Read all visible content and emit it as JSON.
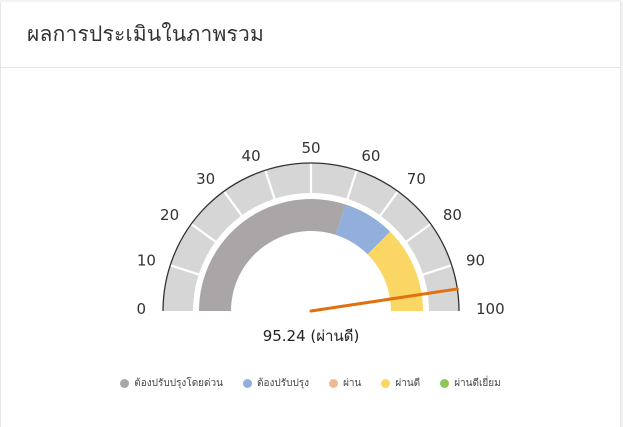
{
  "header": {
    "title": "ผลการประเมินในภาพรวม"
  },
  "chart_data": {
    "type": "gauge",
    "title": "",
    "min": 0,
    "max": 100,
    "ticks": [
      "0",
      "10",
      "20",
      "30",
      "40",
      "50",
      "60",
      "70",
      "80",
      "90",
      "100"
    ],
    "value": 95.24,
    "value_label": "95.24 (ผ่านดี)",
    "bands": [
      {
        "name": "ต้องปรับปรุงโดยด่วน",
        "from": 0,
        "to": 60,
        "color": "#aaa6a8"
      },
      {
        "name": "ต้องปรับปรุง",
        "from": 60,
        "to": 75,
        "color": "#92aedb"
      },
      {
        "name": "ผ่าน",
        "from": 75,
        "to": 75,
        "color": "#f0b893"
      },
      {
        "name": "ผ่านดี",
        "from": 75,
        "to": 100,
        "color": "#fad765"
      },
      {
        "name": "ผ่านดีเยี่ยม",
        "from": 100,
        "to": 100,
        "color": "#8ac85b"
      }
    ],
    "needle_color": "#e07010",
    "outer_band_color": "#d6d6d6",
    "legend": [
      {
        "label": "ต้องปรับปรุงโดยด่วน",
        "color": "#aaa6a8"
      },
      {
        "label": "ต้องปรับปรุง",
        "color": "#92aedb"
      },
      {
        "label": "ผ่าน",
        "color": "#f0b893"
      },
      {
        "label": "ผ่านดี",
        "color": "#fad765"
      },
      {
        "label": "ผ่านดีเยี่ยม",
        "color": "#8ac85b"
      }
    ]
  }
}
